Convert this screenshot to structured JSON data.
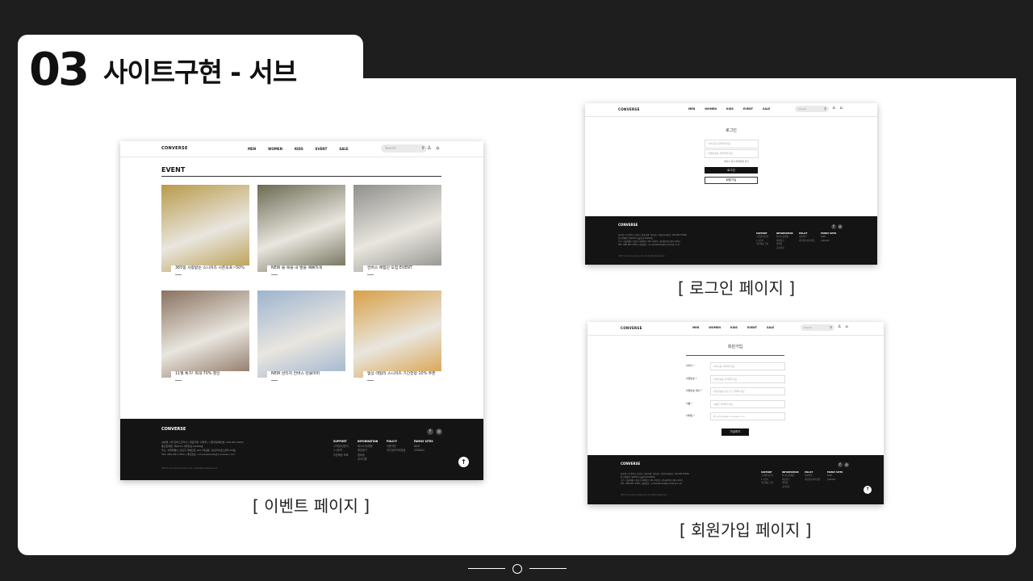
{
  "slide": {
    "number": "03",
    "title": "사이트구현 - 서브"
  },
  "site": {
    "logo": "CONVERSE",
    "nav": [
      "MEN",
      "WOMEN",
      "KIDS",
      "EVENT",
      "SALE"
    ],
    "search_placeholder": "Search",
    "footer": {
      "logo": "CONVERSE",
      "company_lines": [
        "상호명: (주)컨버스코리아  |  대표자명: 이미희  |  사업자등록번호: 220-88-74616",
        "통신판매업: 제2019-서울강남-04299호",
        "주소: 서울특별시 강남구 테헤란로 152 (역삼동, 강남파이낸스센터 20층)",
        "TEL: 080-987-7050  |  개인정보: conversekorea@converse.co.kr"
      ],
      "copyright": "2023 Converse Korea Ltd. All Rights Reserved",
      "columns": [
        {
          "head": "SUPPORT",
          "items": [
            "고객센터/문의",
            "1:1문의",
            "주문배송 조회"
          ]
        },
        {
          "head": "INFORMATION",
          "items": [
            "회사소개/채용",
            "매장찾기",
            "멤버쉽",
            "공지사항"
          ]
        },
        {
          "head": "POLICY",
          "items": [
            "이용약관",
            "개인정보처리방침"
          ]
        },
        {
          "head": "FAMILY SITES",
          "items": [
            "NIKE",
            "JORDAN"
          ]
        }
      ],
      "social": [
        "f",
        "◎"
      ],
      "top_button": "↑"
    }
  },
  "event_page": {
    "heading": "EVENT",
    "items": [
      {
        "label": "365일 사랑받는 스니커즈 시즌오프~50%",
        "color": "#b89a4a"
      },
      {
        "label": "NEW 블 복을 내 발을 예쁘하게",
        "color": "#6b6a52"
      },
      {
        "label": "컨버스 체험단 모집 EVENT",
        "color": "#8f8f8c"
      },
      {
        "label": "11월 특가! 최대 70% 할인",
        "color": "#8a7260"
      },
      {
        "label": "NEW 빈티지 컨버스 런볼마퍼",
        "color": "#9db4cf"
      },
      {
        "label": "일상 데일리 스니커즈 기간한정 10% 쿠폰",
        "color": "#d8a048"
      }
    ],
    "caption": "[ 이벤트 페이지 ]"
  },
  "login_page": {
    "title": "로그인",
    "id_placeholder": "아이디를 입력해주세요",
    "pw_placeholder": "비밀번호를 입력해주세요",
    "links": "아이디 찾기  비밀번호 찾기",
    "login_button": "로그인",
    "join_button": "회원가입",
    "caption": "[ 로그인 페이지 ]"
  },
  "signup_page": {
    "title": "회원가입",
    "fields": [
      {
        "label": "아이디 *",
        "placeholder": "아이디를 입력해주세요"
      },
      {
        "label": "비밀번호 *",
        "placeholder": "비밀번호를 입력해주세요"
      },
      {
        "label": "비밀번호 확인 *",
        "placeholder": "비밀번호를 한번 더 입력해주세요"
      },
      {
        "label": "이름 *",
        "placeholder": "이름을 입력해주세요"
      },
      {
        "label": "이메일 *",
        "placeholder": "예: abcdefg@converse.co.kr"
      }
    ],
    "submit_button": "가입하기",
    "caption": "[ 회원가입 페이지 ]"
  }
}
